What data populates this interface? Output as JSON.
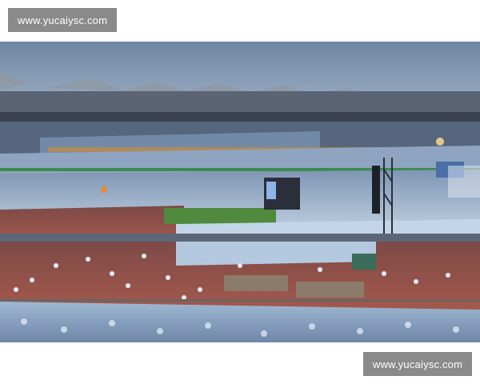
{
  "watermark_top": {
    "text": "www.yucaiysc.com"
  },
  "watermark_bottom": {
    "text": "www.yucaiysc.com"
  },
  "photo": {
    "subject": "stadium-concert-at-dusk",
    "colors": {
      "sky": "#7d93ae",
      "roof": "#4a5566",
      "crowd": "#b8cde0",
      "track": "#9a5147",
      "field": "#4f8a3e",
      "stage": "#2a2f3a"
    }
  }
}
